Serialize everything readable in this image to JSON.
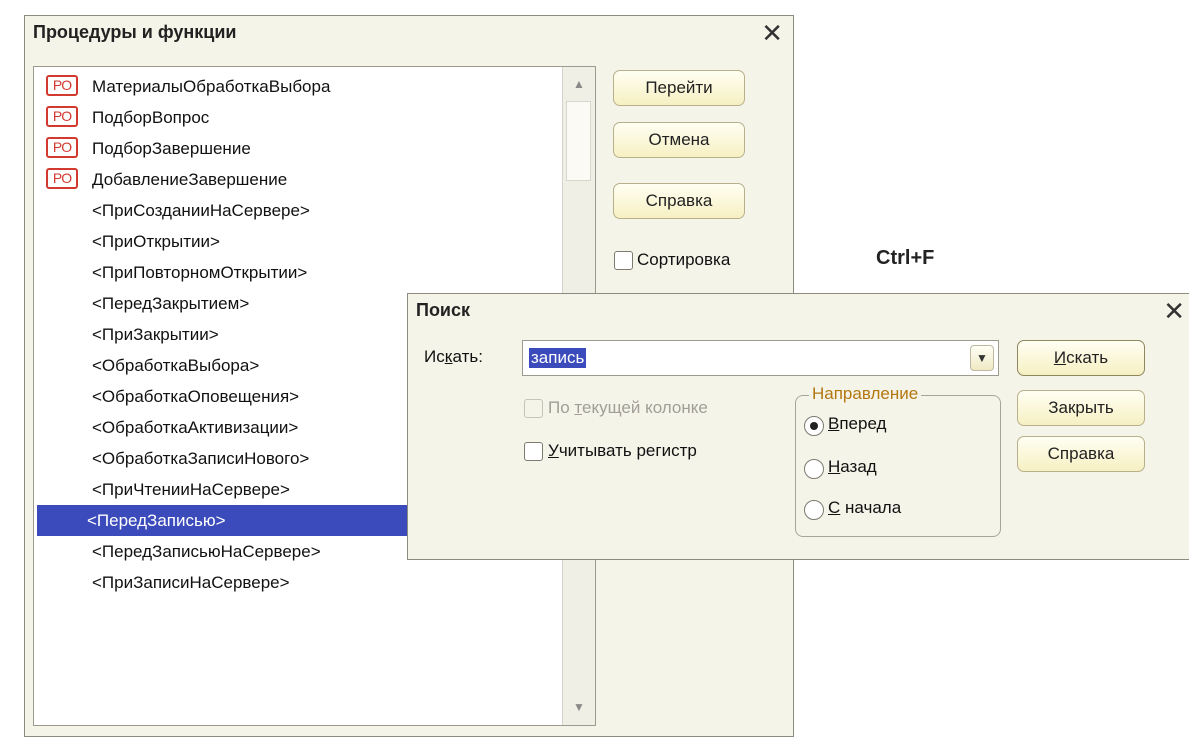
{
  "procedures_dialog": {
    "title": "Процедуры и функции",
    "close": "✕",
    "proc_badge": "PO",
    "items": [
      {
        "label": "МатериалыОбработкаВыбора",
        "badge": true
      },
      {
        "label": "ПодборВопрос",
        "badge": true
      },
      {
        "label": "ПодборЗавершение",
        "badge": true
      },
      {
        "label": "ДобавлениеЗавершение",
        "badge": true
      },
      {
        "label": "<ПриСозданииНаСервере>",
        "badge": false
      },
      {
        "label": "<ПриОткрытии>",
        "badge": false
      },
      {
        "label": "<ПриПовторномОткрытии>",
        "badge": false
      },
      {
        "label": "<ПередЗакрытием>",
        "badge": false
      },
      {
        "label": "<ПриЗакрытии>",
        "badge": false
      },
      {
        "label": "<ОбработкаВыбора>",
        "badge": false
      },
      {
        "label": "<ОбработкаОповещения>",
        "badge": false
      },
      {
        "label": "<ОбработкаАктивизации>",
        "badge": false
      },
      {
        "label": "<ОбработкаЗаписиНового>",
        "badge": false
      },
      {
        "label": "<ПриЧтенииНаСервере>",
        "badge": false
      },
      {
        "label": "<ПередЗаписью>",
        "badge": false,
        "selected": true
      },
      {
        "label": "<ПередЗаписьюНаСервере>",
        "badge": false
      },
      {
        "label": "<ПриЗаписиНаСервере>",
        "badge": false
      }
    ],
    "buttons": {
      "goto": "Перейти",
      "cancel": "Отмена",
      "help": "Справка"
    },
    "sort_label": "Сортировка",
    "scroll_up": "▲",
    "scroll_down": "▼"
  },
  "hint": {
    "shortcut": "Ctrl+F"
  },
  "search_dialog": {
    "title": "Поиск",
    "close": "✕",
    "find_label": "Искать:",
    "find_value": "запись",
    "dropdown_arrow": "▼",
    "current_column_label": "По текущей колонке",
    "case_label": "Учитывать регистр",
    "direction_title": "Направление",
    "directions": [
      "Вперед",
      "Назад",
      "С начала"
    ],
    "selected_direction": "Вперед",
    "buttons": {
      "find": "Искать",
      "close": "Закрыть",
      "help": "Справка"
    }
  },
  "colors": {
    "selection": "#3b4bbb",
    "badge": "#d23a2f",
    "group_title": "#b37710",
    "dialog_bg": "#f5f4e9"
  }
}
